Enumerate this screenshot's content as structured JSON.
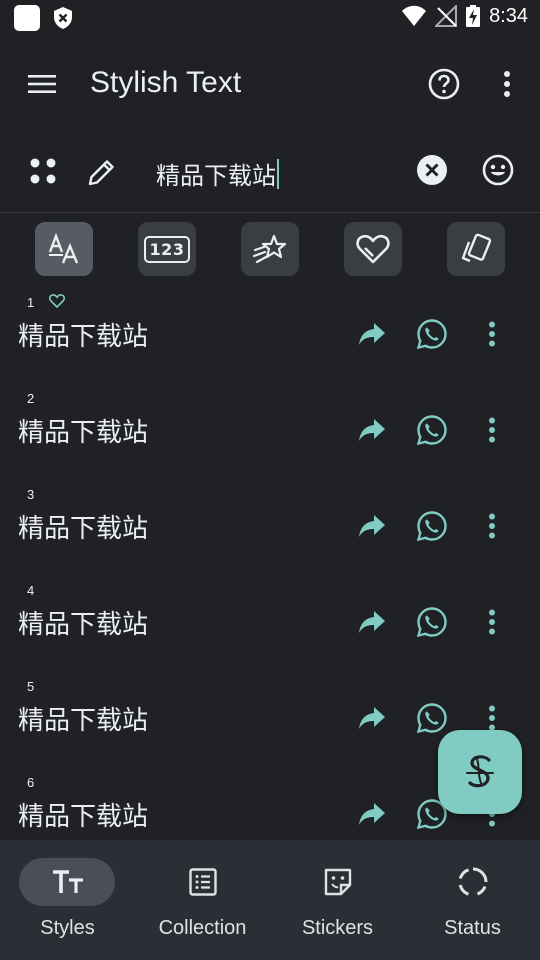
{
  "status_bar": {
    "time": "8:34"
  },
  "app_bar": {
    "title": "Stylish Text"
  },
  "input": {
    "value": "精品下载站"
  },
  "rows": [
    {
      "number": "1",
      "text": "精品下载站",
      "favorite": true
    },
    {
      "number": "2",
      "text": "精品下载站",
      "favorite": false
    },
    {
      "number": "3",
      "text": "精品下载站",
      "favorite": false
    },
    {
      "number": "4",
      "text": "精品下载站",
      "favorite": false
    },
    {
      "number": "5",
      "text": "精品下载站",
      "favorite": false
    },
    {
      "number": "6",
      "text": "精品下载站",
      "favorite": false
    }
  ],
  "filter_chips": [
    {
      "icon": "font-style-icon",
      "active": true
    },
    {
      "icon": "numbers-icon",
      "label": "123",
      "active": false
    },
    {
      "icon": "stars-icon",
      "active": false
    },
    {
      "icon": "heart-icon",
      "active": false
    },
    {
      "icon": "cards-icon",
      "active": false
    }
  ],
  "bottom_nav": [
    {
      "label": "Styles",
      "icon": "text-format-icon",
      "selected": true
    },
    {
      "label": "Collection",
      "icon": "list-icon",
      "selected": false
    },
    {
      "label": "Stickers",
      "icon": "sticker-icon",
      "selected": false
    },
    {
      "label": "Status",
      "icon": "status-ring-icon",
      "selected": false
    }
  ],
  "colors": {
    "background": "#1f2124",
    "accent": "#80cbc4",
    "chip": "#3a3d42",
    "nav": "#2b2f35"
  }
}
